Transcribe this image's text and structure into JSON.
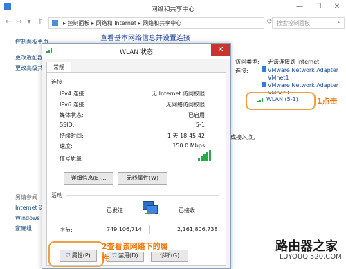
{
  "window": {
    "title": "网络和共享中心",
    "min": "—",
    "max": "☐",
    "close": "✕"
  },
  "address": {
    "path": "▸ 控制面板 ▸ 网络和 Internet ▸ 网络和共享中心",
    "search_placeholder": "搜索控制面板"
  },
  "left_pane": {
    "home": "控制面板主页",
    "items": [
      "更改适配器设置",
      "更改高级共享设置"
    ],
    "see_also_title": "另请参阅",
    "see_also": [
      "Internet 选",
      "Windows 防",
      "家庭组"
    ]
  },
  "main": {
    "heading": "查看基本网络信息并设置连接",
    "access_type_label": "访问类型:",
    "access_type_value": "无法连接到 Internet",
    "connections_label": "连接:",
    "connections": [
      "VMware Network Adapter",
      "VMnet1",
      "VMware Network Adapter",
      "VMnet8"
    ],
    "wlan_link": "WLAN (5-1)",
    "truncated": "或接入点。"
  },
  "annotations": {
    "step1": "1点击",
    "step2_line1": "2查看该网络下的属",
    "step2_line2": "性"
  },
  "dialog": {
    "title": "WLAN 状态",
    "close": "✕",
    "tab": "常规",
    "connection_group": "连接",
    "rows": [
      {
        "label": "IPv4 连接:",
        "value": "无 Internet 访问权限"
      },
      {
        "label": "IPv6 连接:",
        "value": "无网络访问权限"
      },
      {
        "label": "媒体状态:",
        "value": "已启用"
      },
      {
        "label": "SSID:",
        "value": "5-1"
      },
      {
        "label": "持续时间:",
        "value": "1 天 18:45:42"
      },
      {
        "label": "速度:",
        "value": "150.0 Mbps"
      }
    ],
    "signal_label": "信号质量:",
    "details_button": "详细信息(E)...",
    "wireless_button": "无线属性(W)",
    "activity_group": "活动",
    "sent_label": "已发送",
    "received_label": "已接收",
    "bytes_label": "字节:",
    "bytes_sent": "749,106,714",
    "bytes_received": "2,161,806,738",
    "properties_button": "属性(P)",
    "disable_button": "禁用(D)",
    "diagnose_button": "诊断(G)"
  },
  "watermark": {
    "brand": "路由器之家",
    "url": "LUYOUQI520.COM"
  },
  "colors": {
    "annotation": "#f07a10",
    "link": "#1a4a9a",
    "signal": "#2aa84a",
    "close_red": "#c7352f"
  }
}
